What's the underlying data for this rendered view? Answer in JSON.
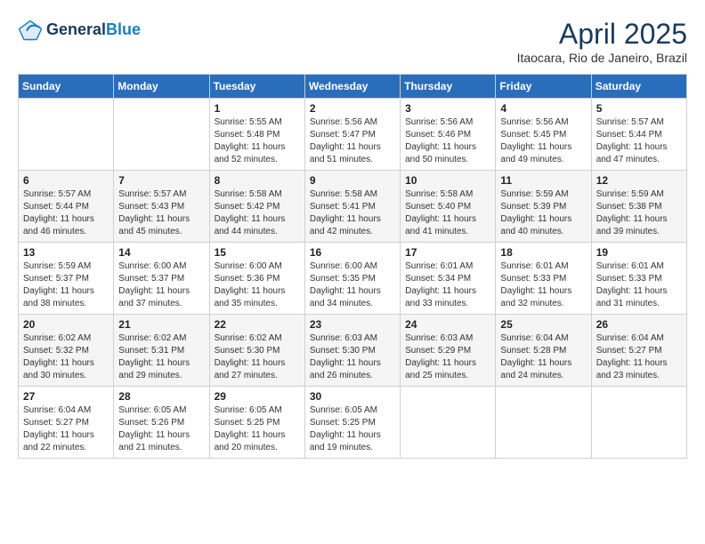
{
  "header": {
    "logo_line1": "General",
    "logo_line2": "Blue",
    "month": "April 2025",
    "location": "Itaocara, Rio de Janeiro, Brazil"
  },
  "weekdays": [
    "Sunday",
    "Monday",
    "Tuesday",
    "Wednesday",
    "Thursday",
    "Friday",
    "Saturday"
  ],
  "weeks": [
    [
      {
        "day": null
      },
      {
        "day": null
      },
      {
        "day": "1",
        "sunrise": "Sunrise: 5:55 AM",
        "sunset": "Sunset: 5:48 PM",
        "daylight": "Daylight: 11 hours and 52 minutes."
      },
      {
        "day": "2",
        "sunrise": "Sunrise: 5:56 AM",
        "sunset": "Sunset: 5:47 PM",
        "daylight": "Daylight: 11 hours and 51 minutes."
      },
      {
        "day": "3",
        "sunrise": "Sunrise: 5:56 AM",
        "sunset": "Sunset: 5:46 PM",
        "daylight": "Daylight: 11 hours and 50 minutes."
      },
      {
        "day": "4",
        "sunrise": "Sunrise: 5:56 AM",
        "sunset": "Sunset: 5:45 PM",
        "daylight": "Daylight: 11 hours and 49 minutes."
      },
      {
        "day": "5",
        "sunrise": "Sunrise: 5:57 AM",
        "sunset": "Sunset: 5:44 PM",
        "daylight": "Daylight: 11 hours and 47 minutes."
      }
    ],
    [
      {
        "day": "6",
        "sunrise": "Sunrise: 5:57 AM",
        "sunset": "Sunset: 5:44 PM",
        "daylight": "Daylight: 11 hours and 46 minutes."
      },
      {
        "day": "7",
        "sunrise": "Sunrise: 5:57 AM",
        "sunset": "Sunset: 5:43 PM",
        "daylight": "Daylight: 11 hours and 45 minutes."
      },
      {
        "day": "8",
        "sunrise": "Sunrise: 5:58 AM",
        "sunset": "Sunset: 5:42 PM",
        "daylight": "Daylight: 11 hours and 44 minutes."
      },
      {
        "day": "9",
        "sunrise": "Sunrise: 5:58 AM",
        "sunset": "Sunset: 5:41 PM",
        "daylight": "Daylight: 11 hours and 42 minutes."
      },
      {
        "day": "10",
        "sunrise": "Sunrise: 5:58 AM",
        "sunset": "Sunset: 5:40 PM",
        "daylight": "Daylight: 11 hours and 41 minutes."
      },
      {
        "day": "11",
        "sunrise": "Sunrise: 5:59 AM",
        "sunset": "Sunset: 5:39 PM",
        "daylight": "Daylight: 11 hours and 40 minutes."
      },
      {
        "day": "12",
        "sunrise": "Sunrise: 5:59 AM",
        "sunset": "Sunset: 5:38 PM",
        "daylight": "Daylight: 11 hours and 39 minutes."
      }
    ],
    [
      {
        "day": "13",
        "sunrise": "Sunrise: 5:59 AM",
        "sunset": "Sunset: 5:37 PM",
        "daylight": "Daylight: 11 hours and 38 minutes."
      },
      {
        "day": "14",
        "sunrise": "Sunrise: 6:00 AM",
        "sunset": "Sunset: 5:37 PM",
        "daylight": "Daylight: 11 hours and 37 minutes."
      },
      {
        "day": "15",
        "sunrise": "Sunrise: 6:00 AM",
        "sunset": "Sunset: 5:36 PM",
        "daylight": "Daylight: 11 hours and 35 minutes."
      },
      {
        "day": "16",
        "sunrise": "Sunrise: 6:00 AM",
        "sunset": "Sunset: 5:35 PM",
        "daylight": "Daylight: 11 hours and 34 minutes."
      },
      {
        "day": "17",
        "sunrise": "Sunrise: 6:01 AM",
        "sunset": "Sunset: 5:34 PM",
        "daylight": "Daylight: 11 hours and 33 minutes."
      },
      {
        "day": "18",
        "sunrise": "Sunrise: 6:01 AM",
        "sunset": "Sunset: 5:33 PM",
        "daylight": "Daylight: 11 hours and 32 minutes."
      },
      {
        "day": "19",
        "sunrise": "Sunrise: 6:01 AM",
        "sunset": "Sunset: 5:33 PM",
        "daylight": "Daylight: 11 hours and 31 minutes."
      }
    ],
    [
      {
        "day": "20",
        "sunrise": "Sunrise: 6:02 AM",
        "sunset": "Sunset: 5:32 PM",
        "daylight": "Daylight: 11 hours and 30 minutes."
      },
      {
        "day": "21",
        "sunrise": "Sunrise: 6:02 AM",
        "sunset": "Sunset: 5:31 PM",
        "daylight": "Daylight: 11 hours and 29 minutes."
      },
      {
        "day": "22",
        "sunrise": "Sunrise: 6:02 AM",
        "sunset": "Sunset: 5:30 PM",
        "daylight": "Daylight: 11 hours and 27 minutes."
      },
      {
        "day": "23",
        "sunrise": "Sunrise: 6:03 AM",
        "sunset": "Sunset: 5:30 PM",
        "daylight": "Daylight: 11 hours and 26 minutes."
      },
      {
        "day": "24",
        "sunrise": "Sunrise: 6:03 AM",
        "sunset": "Sunset: 5:29 PM",
        "daylight": "Daylight: 11 hours and 25 minutes."
      },
      {
        "day": "25",
        "sunrise": "Sunrise: 6:04 AM",
        "sunset": "Sunset: 5:28 PM",
        "daylight": "Daylight: 11 hours and 24 minutes."
      },
      {
        "day": "26",
        "sunrise": "Sunrise: 6:04 AM",
        "sunset": "Sunset: 5:27 PM",
        "daylight": "Daylight: 11 hours and 23 minutes."
      }
    ],
    [
      {
        "day": "27",
        "sunrise": "Sunrise: 6:04 AM",
        "sunset": "Sunset: 5:27 PM",
        "daylight": "Daylight: 11 hours and 22 minutes."
      },
      {
        "day": "28",
        "sunrise": "Sunrise: 6:05 AM",
        "sunset": "Sunset: 5:26 PM",
        "daylight": "Daylight: 11 hours and 21 minutes."
      },
      {
        "day": "29",
        "sunrise": "Sunrise: 6:05 AM",
        "sunset": "Sunset: 5:25 PM",
        "daylight": "Daylight: 11 hours and 20 minutes."
      },
      {
        "day": "30",
        "sunrise": "Sunrise: 6:05 AM",
        "sunset": "Sunset: 5:25 PM",
        "daylight": "Daylight: 11 hours and 19 minutes."
      },
      {
        "day": null
      },
      {
        "day": null
      },
      {
        "day": null
      }
    ]
  ]
}
